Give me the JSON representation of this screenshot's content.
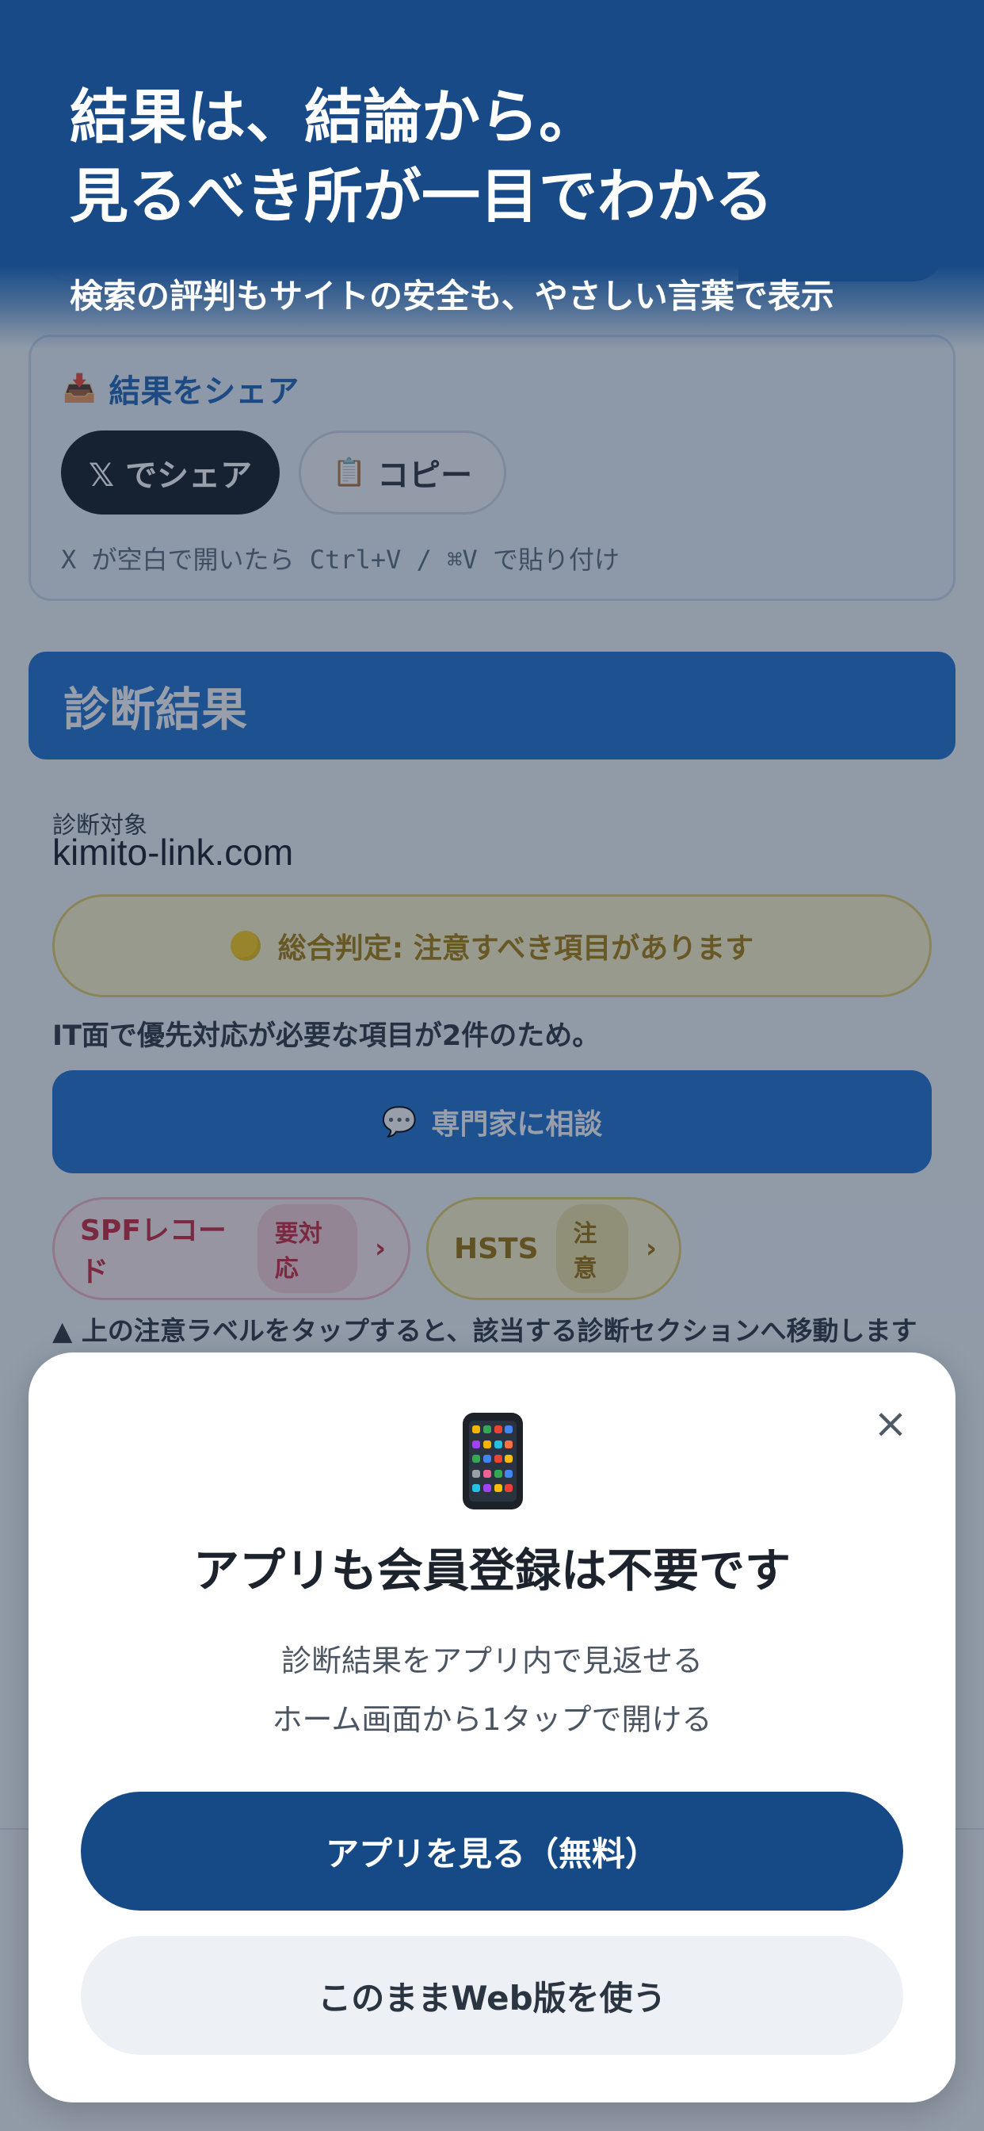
{
  "hero": {
    "title_line1": "結果は、結論から。",
    "title_line2": "見るべき所が一目でわかる",
    "subtitle": "検索の評判もサイトの安全も、やさしい言葉で表示"
  },
  "share": {
    "icon": "📥",
    "title": "結果をシェア",
    "x_button": "𝕏 でシェア",
    "copy_icon": "📋",
    "copy_button": "コピー",
    "hint": "X が空白で開いたら Ctrl+V / ⌘V で貼り付け"
  },
  "result": {
    "header": "診断結果",
    "target_label": "診断対象",
    "target_domain": "kimito-link.com",
    "verdict": "総合判定: 注意すべき項目があります",
    "reason": "IT面で優先対応が必要な項目が2件のため。",
    "consult_icon": "💬",
    "consult_button": "専門家に相談",
    "chips": [
      {
        "label": "SPFレコード",
        "tag": "要対応",
        "chev": "›"
      },
      {
        "label": "HSTS",
        "tag": "注意",
        "chev": "›"
      }
    ],
    "tap_note": "▲ 上の注意ラベルをタップすると、該当する診断セクションへ移動します"
  },
  "modal": {
    "close": "×",
    "icon": "phone-icon",
    "title": "アプリも会員登録は不要です",
    "line1": "診断結果をアプリ内で見返せる",
    "line2": "ホーム画面から1タップで開ける",
    "primary_button": "アプリを見る（無料）",
    "secondary_button": "このままWeb版を使う"
  },
  "colors": {
    "brand_dark": "#154a86",
    "brand_blue": "#1f6fd0",
    "warning": "#ffcf16",
    "danger": "#c8283c"
  }
}
